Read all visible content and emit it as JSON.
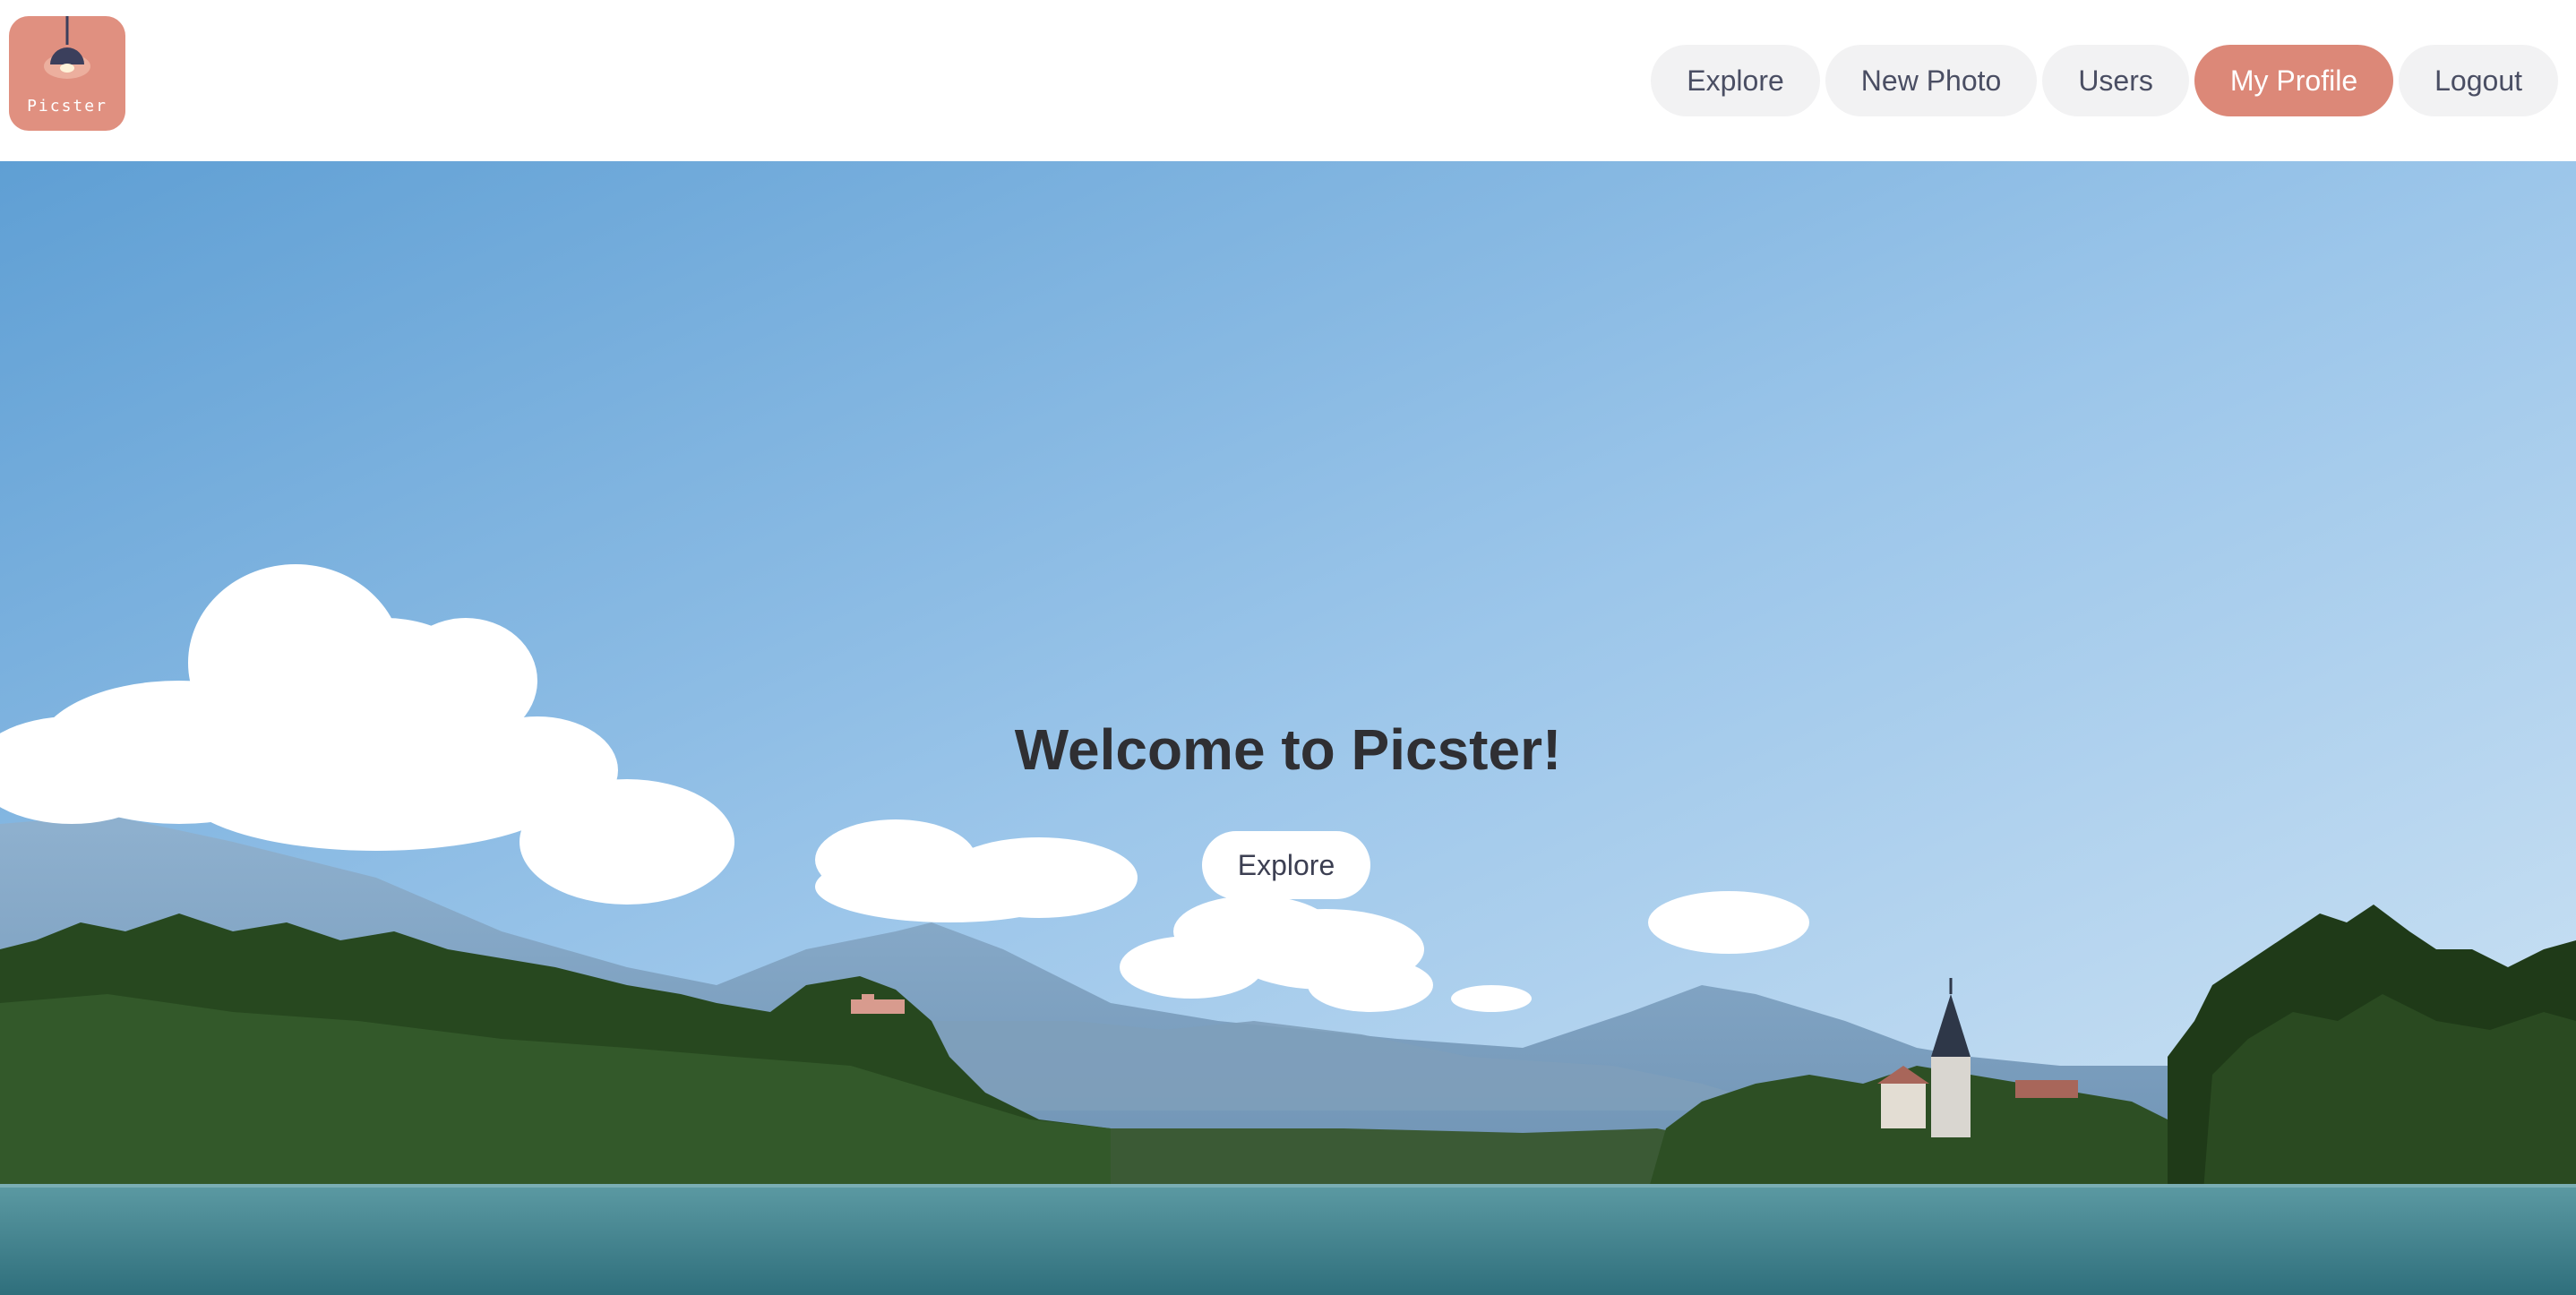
{
  "app": {
    "logo_text": "Picster"
  },
  "nav": {
    "explore": "Explore",
    "new_photo": "New Photo",
    "users": "Users",
    "my_profile": "My Profile",
    "logout": "Logout"
  },
  "hero": {
    "title": "Welcome to Picster!",
    "button": "Explore"
  },
  "colors": {
    "accent": "#dc8878",
    "nav_bg": "#f2f2f3",
    "nav_text": "#4a4e63",
    "title_text": "#2f2f33"
  }
}
